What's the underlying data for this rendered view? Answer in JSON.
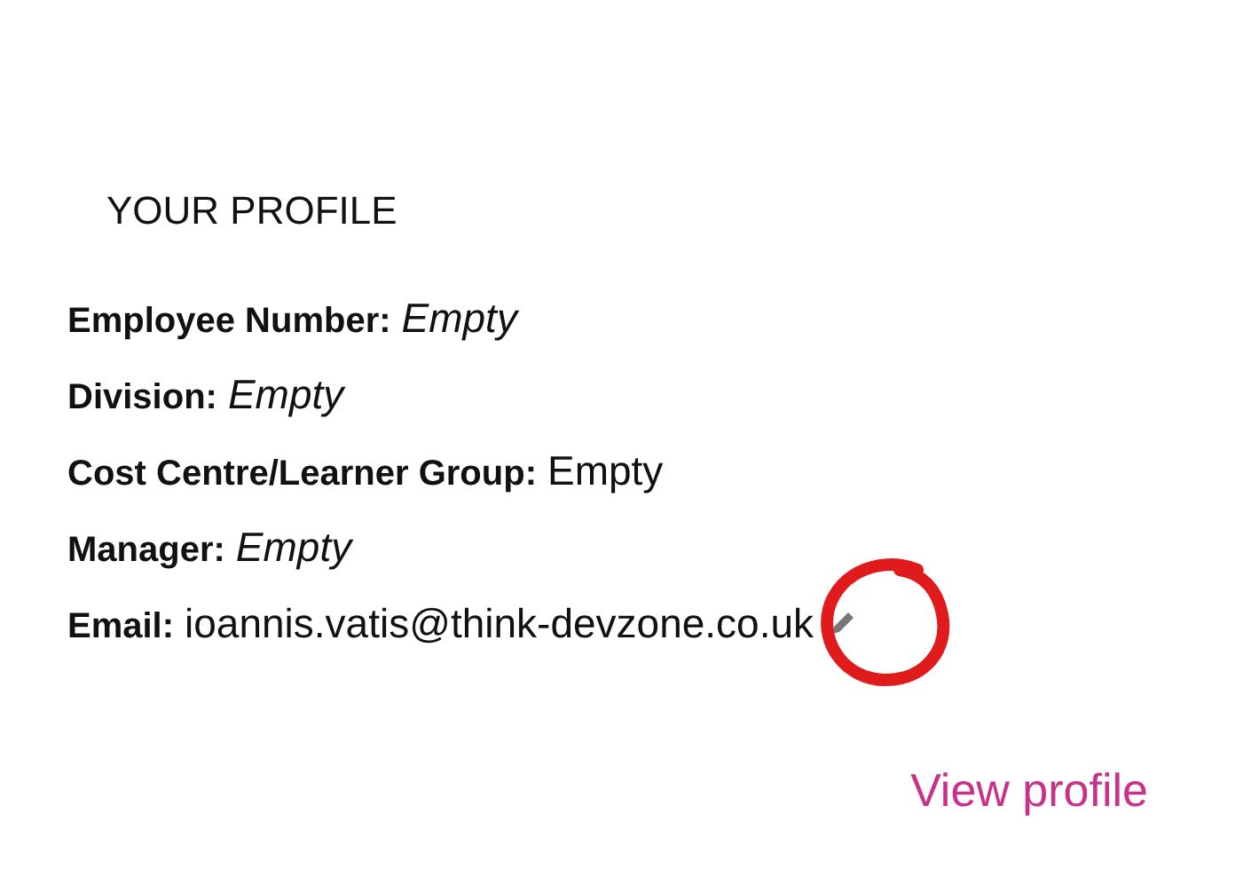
{
  "section_title": "YOUR PROFILE",
  "fields": [
    {
      "label": "Employee Number:",
      "value": "Empty",
      "italic": true,
      "editable": false
    },
    {
      "label": "Division:",
      "value": "Empty",
      "italic": true,
      "editable": false
    },
    {
      "label": "Cost Centre/Learner Group:",
      "value": "Empty",
      "italic": false,
      "editable": false
    },
    {
      "label": "Manager:",
      "value": "Empty",
      "italic": true,
      "editable": false
    },
    {
      "label": "Email:",
      "value": "ioannis.vatis@think-devzone.co.uk",
      "italic": false,
      "editable": true
    }
  ],
  "link": "View profile"
}
